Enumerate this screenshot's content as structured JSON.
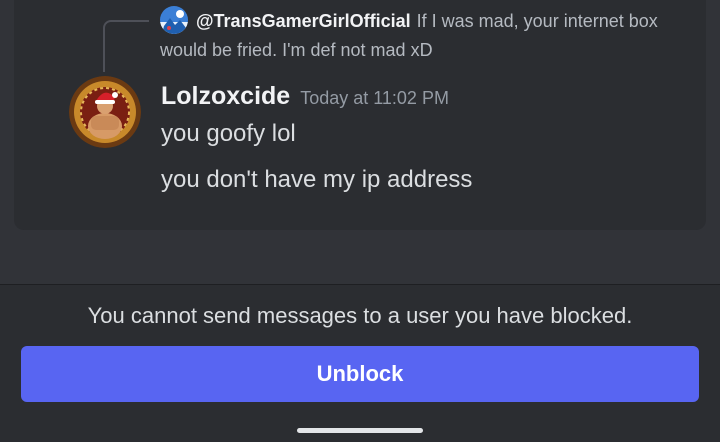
{
  "reply": {
    "author": "@TransGamerGirlOfficial",
    "preview": "If I was mad, your internet box would be fried. I'm def not mad xD",
    "avatar_icon": "reply-author-avatar"
  },
  "message": {
    "author": "Lolzoxcide",
    "timestamp": "Today at 11:02 PM",
    "lines": [
      "you goofy lol",
      "you don't have my ip address"
    ],
    "avatar_icon": "santa-hat-avatar"
  },
  "blocked": {
    "notice": "You cannot send messages to a user you have blocked.",
    "unblock_label": "Unblock"
  },
  "colors": {
    "background": "#313338",
    "card": "#2b2d31",
    "accent": "#5865f2",
    "text": "#dbdee1",
    "muted": "#949ba4"
  }
}
